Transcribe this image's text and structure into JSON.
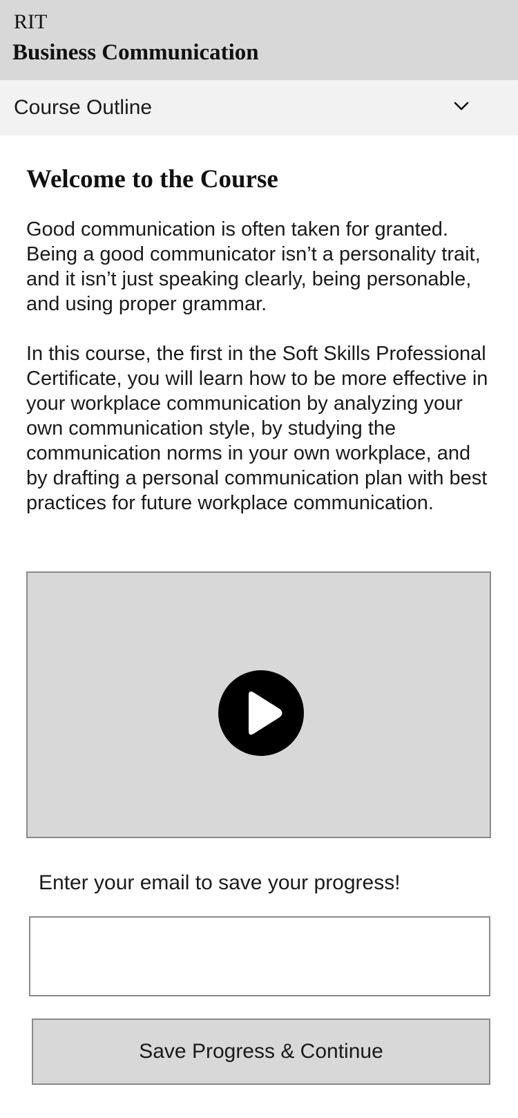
{
  "header": {
    "org": "RIT",
    "course_title": "Business Communication"
  },
  "outline": {
    "label": "Course Outline",
    "icon": "chevron-down-icon"
  },
  "main": {
    "heading": "Welcome to the Course",
    "paragraphs": [
      "Good communication is often taken for granted. Being a good communicator isn’t a personality trait, and it isn’t just speaking clearly, being personable, and using proper grammar.",
      "In this course, the first in the Soft Skills Professional Certificate, you will learn how to be more effective in your workplace communication by analyzing your own communication style, by studying the communication norms in your own workplace, and by drafting a personal communication plan with best practices for future workplace communication."
    ],
    "video": {
      "icon": "play-icon"
    }
  },
  "form": {
    "email_prompt": "Enter your email to save your progress!",
    "email_value": "",
    "email_placeholder": "",
    "submit_label": "Save Progress & Continue"
  },
  "colors": {
    "header_bg": "#d8d8d8",
    "outline_bg": "#f2f2f2",
    "video_bg": "#d8d8d8",
    "button_bg": "#d8d8d8",
    "border": "#8a8a8a",
    "text": "#1a1a1a"
  }
}
